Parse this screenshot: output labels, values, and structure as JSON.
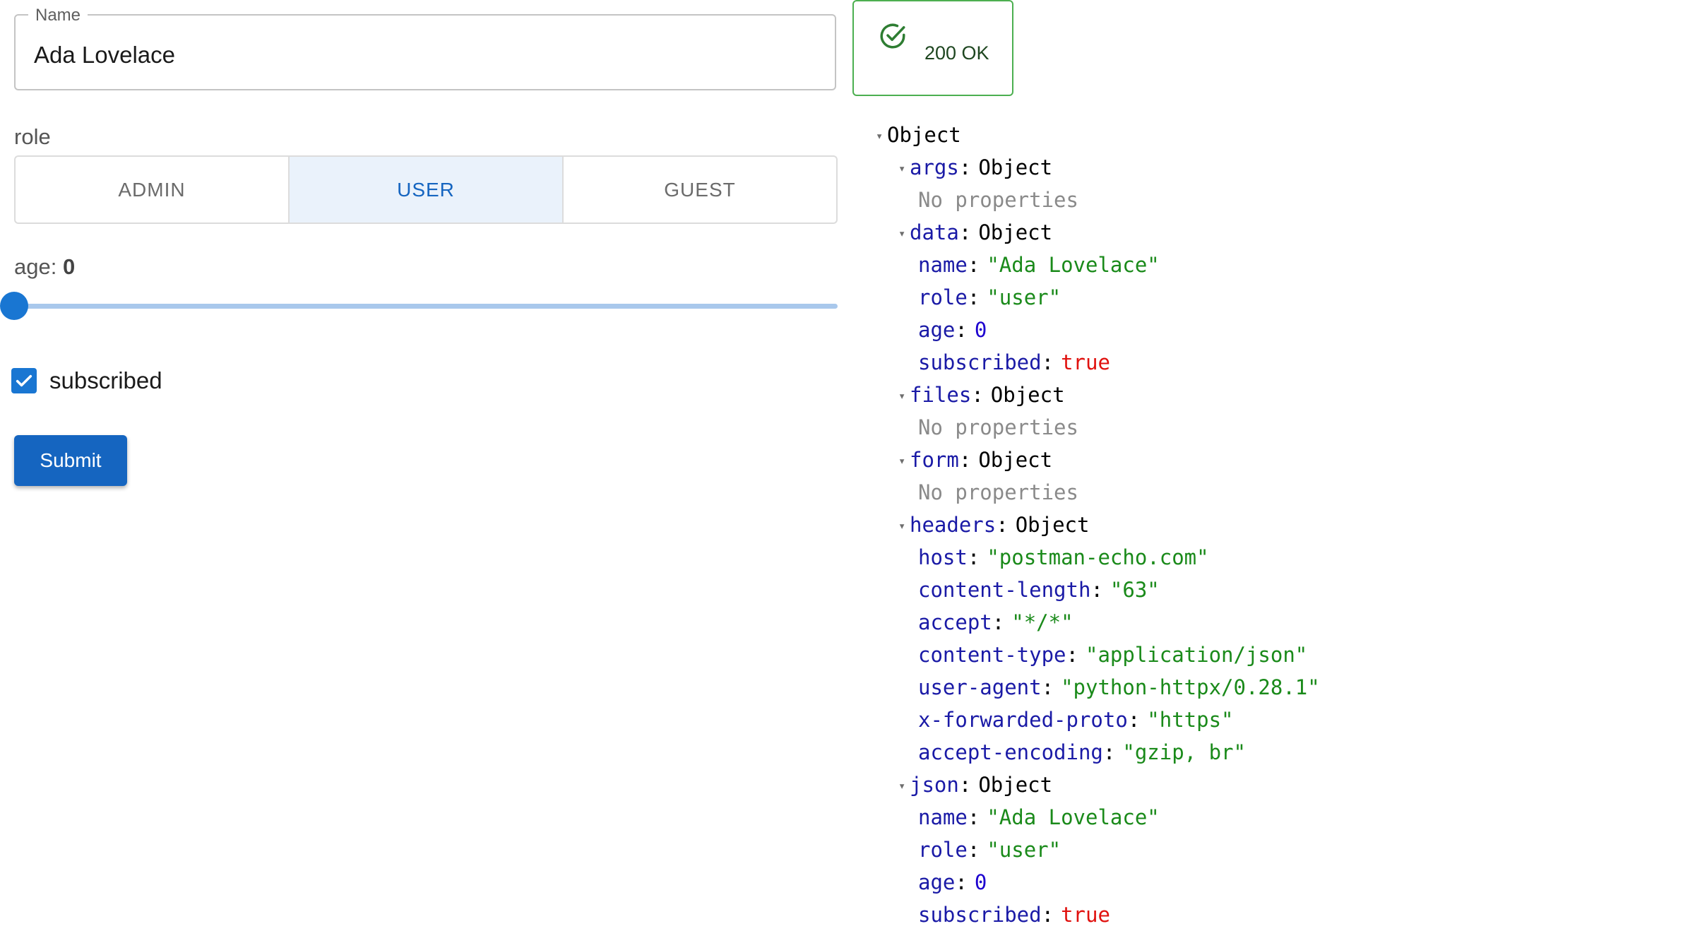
{
  "form": {
    "name_legend": "Name",
    "name_value": "Ada Lovelace",
    "role_label": "role",
    "roles": [
      "ADMIN",
      "USER",
      "GUEST"
    ],
    "selected_role": "USER",
    "age_label": "age:",
    "age_value": "0",
    "slider_value": 0,
    "checkbox_label": "subscribed",
    "checkbox_checked": true,
    "submit_label": "Submit"
  },
  "status": {
    "text": "200 OK",
    "icon": "check-circle-icon",
    "color": "#4caf50"
  },
  "inspector": {
    "rows": [
      {
        "level": 0,
        "arrow": true,
        "label": "Object"
      },
      {
        "level": 1,
        "arrow": true,
        "key": "args",
        "value": "Object",
        "vtype": "obj"
      },
      {
        "level": 2,
        "muted": "No properties"
      },
      {
        "level": 1,
        "arrow": true,
        "key": "data",
        "value": "Object",
        "vtype": "obj"
      },
      {
        "level": 2,
        "key": "name",
        "value": "\"Ada Lovelace\"",
        "vtype": "str"
      },
      {
        "level": 2,
        "key": "role",
        "value": "\"user\"",
        "vtype": "str"
      },
      {
        "level": 2,
        "key": "age",
        "value": "0",
        "vtype": "num"
      },
      {
        "level": 2,
        "key": "subscribed",
        "value": "true",
        "vtype": "bool"
      },
      {
        "level": 1,
        "arrow": true,
        "key": "files",
        "value": "Object",
        "vtype": "obj"
      },
      {
        "level": 2,
        "muted": "No properties"
      },
      {
        "level": 1,
        "arrow": true,
        "key": "form",
        "value": "Object",
        "vtype": "obj"
      },
      {
        "level": 2,
        "muted": "No properties"
      },
      {
        "level": 1,
        "arrow": true,
        "key": "headers",
        "value": "Object",
        "vtype": "obj"
      },
      {
        "level": 2,
        "key": "host",
        "value": "\"postman-echo.com\"",
        "vtype": "str"
      },
      {
        "level": 2,
        "key": "content-length",
        "value": "\"63\"",
        "vtype": "str"
      },
      {
        "level": 2,
        "key": "accept",
        "value": "\"*/*\"",
        "vtype": "str"
      },
      {
        "level": 2,
        "key": "content-type",
        "value": "\"application/json\"",
        "vtype": "str"
      },
      {
        "level": 2,
        "key": "user-agent",
        "value": "\"python-httpx/0.28.1\"",
        "vtype": "str"
      },
      {
        "level": 2,
        "key": "x-forwarded-proto",
        "value": "\"https\"",
        "vtype": "str"
      },
      {
        "level": 2,
        "key": "accept-encoding",
        "value": "\"gzip, br\"",
        "vtype": "str"
      },
      {
        "level": 1,
        "arrow": true,
        "key": "json",
        "value": "Object",
        "vtype": "obj"
      },
      {
        "level": 2,
        "key": "name",
        "value": "\"Ada Lovelace\"",
        "vtype": "str"
      },
      {
        "level": 2,
        "key": "role",
        "value": "\"user\"",
        "vtype": "str"
      },
      {
        "level": 2,
        "key": "age",
        "value": "0",
        "vtype": "num"
      },
      {
        "level": 2,
        "key": "subscribed",
        "value": "true",
        "vtype": "bool"
      }
    ]
  }
}
